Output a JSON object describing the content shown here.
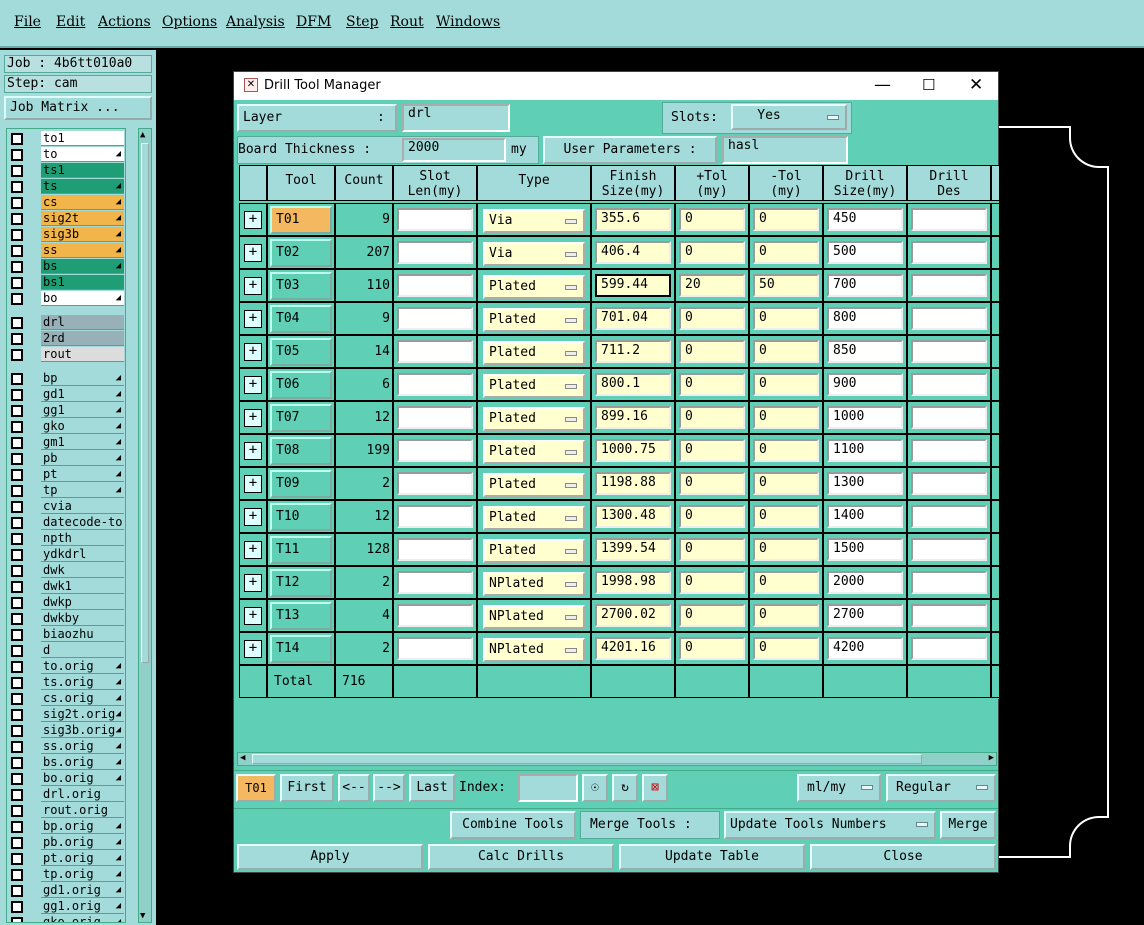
{
  "menu": [
    "File",
    "Edit",
    "Actions",
    "Options",
    "Analysis",
    "DFM",
    "Step",
    "Rout",
    "Windows"
  ],
  "job": {
    "job_line": "Job : 4b6tt010a0",
    "step_line": "Step: cam",
    "matrix_button": "Job Matrix ..."
  },
  "layers": [
    {
      "name": "to1",
      "bg": "#ffffff",
      "mark": ""
    },
    {
      "name": "to",
      "bg": "#ffffff",
      "mark": "◢"
    },
    {
      "name": "ts1",
      "bg": "#1f9e76",
      "mark": ""
    },
    {
      "name": "ts",
      "bg": "#1f9e76",
      "mark": "◢"
    },
    {
      "name": "cs",
      "bg": "#f2b54a",
      "mark": "◢"
    },
    {
      "name": "sig2t",
      "bg": "#f2b54a",
      "mark": "◢"
    },
    {
      "name": "sig3b",
      "bg": "#f2b54a",
      "mark": "◢"
    },
    {
      "name": "ss",
      "bg": "#f2b54a",
      "mark": "◢"
    },
    {
      "name": "bs",
      "bg": "#1f9e76",
      "mark": "◢"
    },
    {
      "name": "bs1",
      "bg": "#1f9e76",
      "mark": ""
    },
    {
      "name": "bo",
      "bg": "#ffffff",
      "mark": "◢"
    },
    {
      "name": "drl",
      "bg": "#98b0b8",
      "mark": "",
      "gap": true
    },
    {
      "name": "2rd",
      "bg": "#98b0b8",
      "mark": ""
    },
    {
      "name": "rout",
      "bg": "#dcdcdc",
      "mark": ""
    },
    {
      "name": "bp",
      "bg": "#a3dbdb",
      "mark": "◢",
      "gap": true
    },
    {
      "name": "gd1",
      "bg": "#a3dbdb",
      "mark": "◢"
    },
    {
      "name": "gg1",
      "bg": "#a3dbdb",
      "mark": "◢"
    },
    {
      "name": "gko",
      "bg": "#a3dbdb",
      "mark": "◢"
    },
    {
      "name": "gm1",
      "bg": "#a3dbdb",
      "mark": "◢"
    },
    {
      "name": "pb",
      "bg": "#a3dbdb",
      "mark": "◢"
    },
    {
      "name": "pt",
      "bg": "#a3dbdb",
      "mark": "◢"
    },
    {
      "name": "tp",
      "bg": "#a3dbdb",
      "mark": "◢"
    },
    {
      "name": "cvia",
      "bg": "#a3dbdb",
      "mark": ""
    },
    {
      "name": "datecode-to",
      "bg": "#a3dbdb",
      "mark": ""
    },
    {
      "name": "npth",
      "bg": "#a3dbdb",
      "mark": ""
    },
    {
      "name": "ydkdrl",
      "bg": "#a3dbdb",
      "mark": ""
    },
    {
      "name": "dwk",
      "bg": "#a3dbdb",
      "mark": ""
    },
    {
      "name": "dwk1",
      "bg": "#a3dbdb",
      "mark": ""
    },
    {
      "name": "dwkp",
      "bg": "#a3dbdb",
      "mark": ""
    },
    {
      "name": "dwkby",
      "bg": "#a3dbdb",
      "mark": ""
    },
    {
      "name": "biaozhu",
      "bg": "#a3dbdb",
      "mark": ""
    },
    {
      "name": "d",
      "bg": "#a3dbdb",
      "mark": ""
    },
    {
      "name": "to.orig",
      "bg": "#a3dbdb",
      "mark": "◢"
    },
    {
      "name": "ts.orig",
      "bg": "#a3dbdb",
      "mark": "◢"
    },
    {
      "name": "cs.orig",
      "bg": "#a3dbdb",
      "mark": "◢"
    },
    {
      "name": "sig2t.orig",
      "bg": "#a3dbdb",
      "mark": "◢"
    },
    {
      "name": "sig3b.orig",
      "bg": "#a3dbdb",
      "mark": "◢"
    },
    {
      "name": "ss.orig",
      "bg": "#a3dbdb",
      "mark": "◢"
    },
    {
      "name": "bs.orig",
      "bg": "#a3dbdb",
      "mark": "◢"
    },
    {
      "name": "bo.orig",
      "bg": "#a3dbdb",
      "mark": "◢"
    },
    {
      "name": "drl.orig",
      "bg": "#a3dbdb",
      "mark": ""
    },
    {
      "name": "rout.orig",
      "bg": "#a3dbdb",
      "mark": ""
    },
    {
      "name": "bp.orig",
      "bg": "#a3dbdb",
      "mark": "◢"
    },
    {
      "name": "pb.orig",
      "bg": "#a3dbdb",
      "mark": "◢"
    },
    {
      "name": "pt.orig",
      "bg": "#a3dbdb",
      "mark": "◢"
    },
    {
      "name": "tp.orig",
      "bg": "#a3dbdb",
      "mark": "◢"
    },
    {
      "name": "gd1.orig",
      "bg": "#a3dbdb",
      "mark": "◢"
    },
    {
      "name": "gg1.orig",
      "bg": "#a3dbdb",
      "mark": "◢"
    },
    {
      "name": "gko.orig",
      "bg": "#a3dbdb",
      "mark": "◢"
    }
  ],
  "dialog": {
    "title": "Drill Tool Manager",
    "layer_label": "Layer",
    "layer_colon": ":",
    "layer_value": "drl",
    "slots_label": "Slots:",
    "slots_value": "Yes",
    "thickness_label": "Board Thickness :",
    "thickness_value": "2000",
    "thickness_unit": "my",
    "user_params_label": "User Parameters :",
    "user_params_value": "hasl",
    "headers": [
      "Tool",
      "Count",
      "Slot\nLen(my)",
      "Type",
      "Finish\nSize(my)",
      "+Tol\n(my)",
      "-Tol\n(my)",
      "Drill\nSize(my)",
      "Drill\nDes"
    ],
    "rows": [
      {
        "tool": "T01",
        "count": "9",
        "type": "Via",
        "finish": "355.6",
        "ptol": "0",
        "mtol": "0",
        "drill": "450",
        "icon": "A"
      },
      {
        "tool": "T02",
        "count": "207",
        "type": "Via",
        "finish": "406.4",
        "ptol": "0",
        "mtol": "0",
        "drill": "500",
        "icon": "B"
      },
      {
        "tool": "T03",
        "count": "110",
        "type": "Plated",
        "finish": "599.44",
        "ptol": "20",
        "mtol": "50",
        "drill": "700",
        "icon": "C"
      },
      {
        "tool": "T04",
        "count": "9",
        "type": "Plated",
        "finish": "701.04",
        "ptol": "0",
        "mtol": "0",
        "drill": "800",
        "icon": "D"
      },
      {
        "tool": "T05",
        "count": "14",
        "type": "Plated",
        "finish": "711.2",
        "ptol": "0",
        "mtol": "0",
        "drill": "850",
        "icon": "E"
      },
      {
        "tool": "T06",
        "count": "6",
        "type": "Plated",
        "finish": "800.1",
        "ptol": "0",
        "mtol": "0",
        "drill": "900",
        "icon": "F"
      },
      {
        "tool": "T07",
        "count": "12",
        "type": "Plated",
        "finish": "899.16",
        "ptol": "0",
        "mtol": "0",
        "drill": "1000",
        "icon": "G"
      },
      {
        "tool": "T08",
        "count": "199",
        "type": "Plated",
        "finish": "1000.75",
        "ptol": "0",
        "mtol": "0",
        "drill": "1100",
        "icon": "H"
      },
      {
        "tool": "T09",
        "count": "2",
        "type": "Plated",
        "finish": "1198.88",
        "ptol": "0",
        "mtol": "0",
        "drill": "1300",
        "icon": "I"
      },
      {
        "tool": "T10",
        "count": "12",
        "type": "Plated",
        "finish": "1300.48",
        "ptol": "0",
        "mtol": "0",
        "drill": "1400",
        "icon": "J"
      },
      {
        "tool": "T11",
        "count": "128",
        "type": "Plated",
        "finish": "1399.54",
        "ptol": "0",
        "mtol": "0",
        "drill": "1500",
        "icon": "K"
      },
      {
        "tool": "T12",
        "count": "2",
        "type": "NPlated",
        "finish": "1998.98",
        "ptol": "0",
        "mtol": "0",
        "drill": "2000",
        "icon": "L"
      },
      {
        "tool": "T13",
        "count": "4",
        "type": "NPlated",
        "finish": "2700.02",
        "ptol": "0",
        "mtol": "0",
        "drill": "2700",
        "icon": "M"
      },
      {
        "tool": "T14",
        "count": "2",
        "type": "NPlated",
        "finish": "4201.16",
        "ptol": "0",
        "mtol": "0",
        "drill": "4200",
        "icon": "N"
      }
    ],
    "total_label": "Total",
    "total_count": "716",
    "nav": {
      "current": "T01",
      "first": "First",
      "prev": "<--",
      "next": "-->",
      "last": "Last",
      "index_label": "Index:",
      "units": "ml/my",
      "mode": "Regular"
    },
    "merge": {
      "combine": "Combine Tools",
      "merge_label": "Merge Tools :",
      "update_numbers": "Update Tools Numbers",
      "merge": "Merge"
    },
    "actions": {
      "apply": "Apply",
      "calc": "Calc Drills",
      "update": "Update Table",
      "close": "Close"
    }
  },
  "colors": {
    "panel": "#a3dbdb",
    "dialog": "#5fcfb6",
    "selected": "#f4b860",
    "field": "#ffffd0"
  }
}
